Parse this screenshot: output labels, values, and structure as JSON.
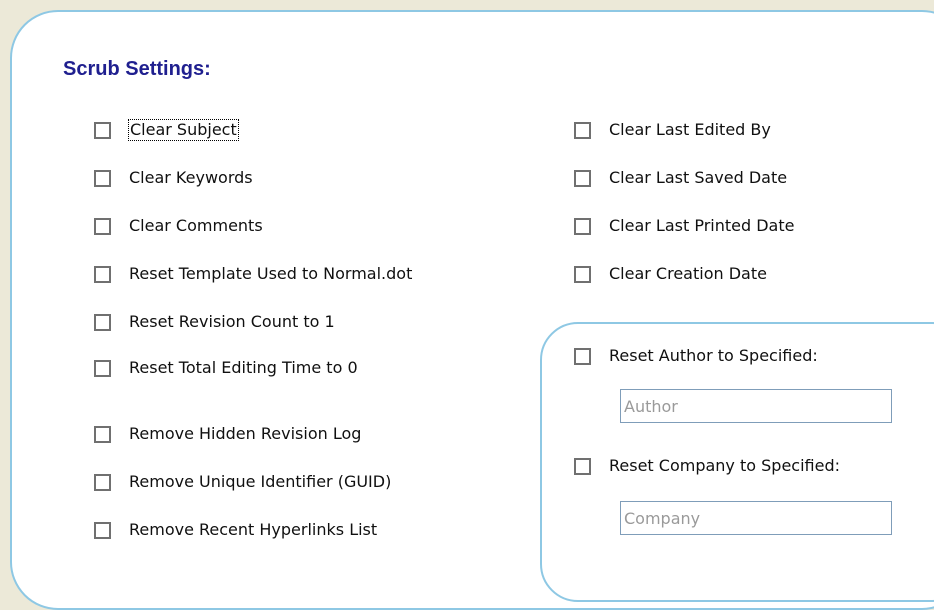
{
  "scrub_settings": {
    "title": "Scrub Settings:",
    "left_options": [
      {
        "label": "Clear Subject",
        "checked": false,
        "focused": true
      },
      {
        "label": "Clear Keywords",
        "checked": false
      },
      {
        "label": "Clear Comments",
        "checked": false
      },
      {
        "label": "Reset Template Used to Normal.dot",
        "checked": false
      },
      {
        "label": "Reset Revision Count to 1",
        "checked": false
      },
      {
        "label": "Reset Total Editing Time to 0",
        "checked": false
      },
      {
        "label": "Remove Hidden Revision Log",
        "checked": false
      },
      {
        "label": "Remove Unique Identifier (GUID)",
        "checked": false
      },
      {
        "label": "Remove Recent Hyperlinks List",
        "checked": false
      }
    ],
    "right_options": [
      {
        "label": "Clear Last Edited By",
        "checked": false
      },
      {
        "label": "Clear Last Saved Date",
        "checked": false
      },
      {
        "label": "Clear Last Printed Date",
        "checked": false
      },
      {
        "label": "Clear Creation Date",
        "checked": false
      }
    ],
    "reset_group": {
      "author_checkbox_label": "Reset Author to Specified:",
      "author_placeholder": "Author",
      "company_checkbox_label": "Reset Company to Specified:",
      "company_placeholder": "Company"
    }
  }
}
